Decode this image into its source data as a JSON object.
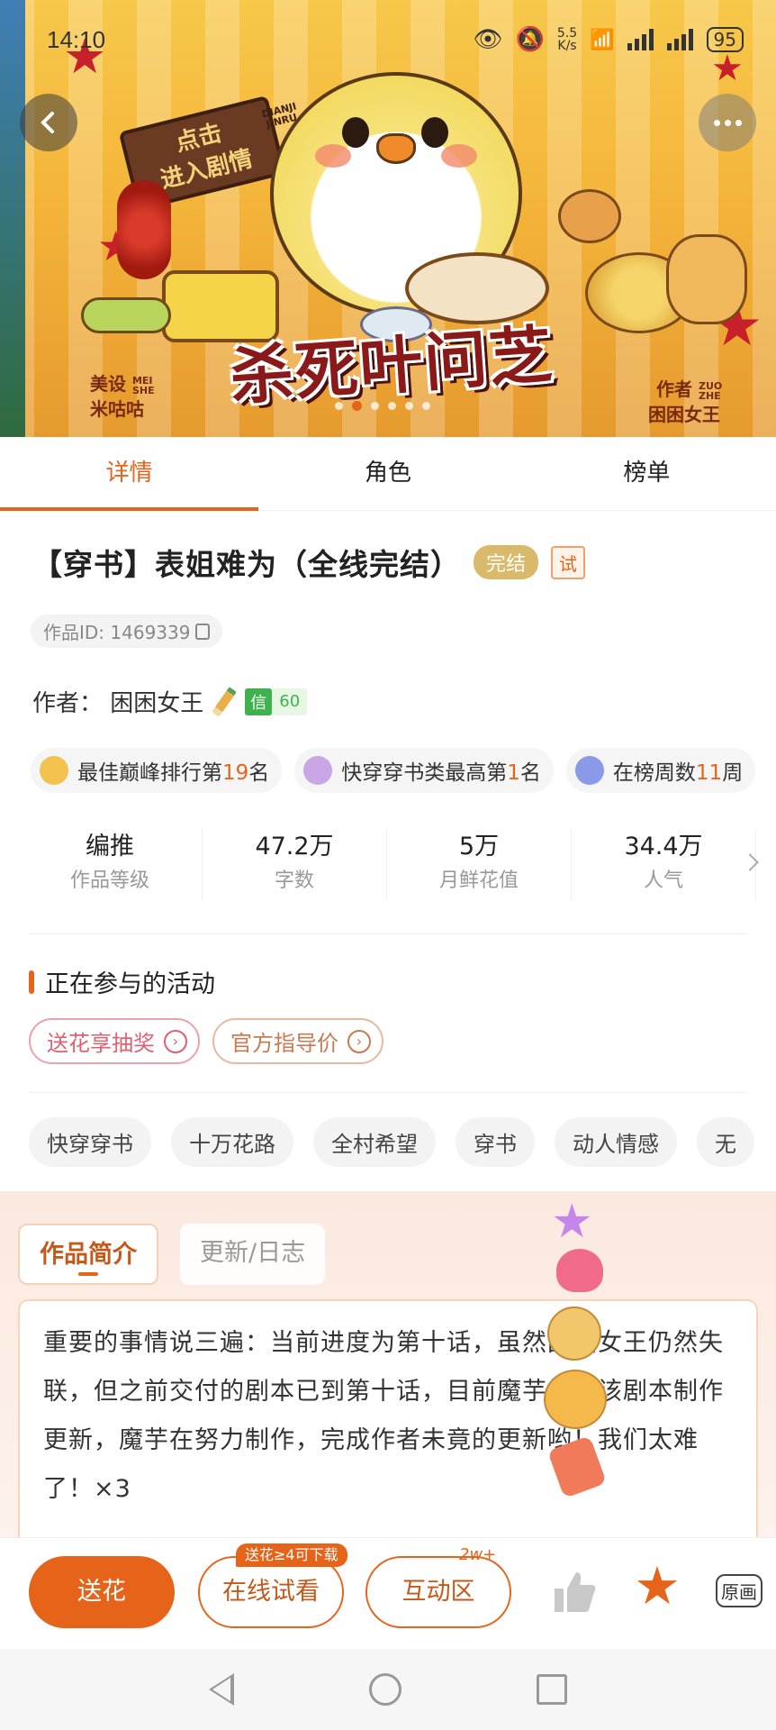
{
  "status_bar": {
    "time": "14:10",
    "net_speed": "5.5\nK/s",
    "battery": "95"
  },
  "banner": {
    "art_title": "杀死叶问芝",
    "sign_text": "点击\n进入剧情",
    "sign_pinyin": "DIANJI\nJINRU",
    "credit_left_role": "美设",
    "credit_left_latin": "MEI\nSHE",
    "credit_left_name": "米咕咕",
    "credit_right_role": "作者",
    "credit_right_latin": "ZUO\nZHE",
    "credit_right_name": "困困女王",
    "page_count": 6,
    "page_active": 2
  },
  "tabs": [
    {
      "label": "详情"
    },
    {
      "label": "角色"
    },
    {
      "label": "榜单"
    }
  ],
  "detail": {
    "title": "【穿书】表姐难为（全线完结）",
    "badge_done": "完结",
    "badge_try": "试",
    "work_id": "作品ID: 1469339",
    "author_label": "作者：",
    "author_name": "困困女王",
    "credit_tag": "信",
    "credit_score": "60"
  },
  "ranks": [
    {
      "pre": "最佳巅峰排行第",
      "num": "19",
      "post": "名",
      "color": "#f2c14e"
    },
    {
      "pre": "快穿穿书类最高第",
      "num": "1",
      "post": "名",
      "color": "#c9a7e6"
    },
    {
      "pre": "在榜周数",
      "num": "11",
      "post": "周",
      "color": "#8a9ae8"
    }
  ],
  "stats": [
    {
      "value": "编推",
      "label": "作品等级"
    },
    {
      "value": "47.2万",
      "label": "字数"
    },
    {
      "value": "5万",
      "label": "月鲜花值"
    },
    {
      "value": "34.4万",
      "label": "人气"
    }
  ],
  "activities": {
    "title": "正在参与的活动",
    "items": [
      {
        "label": "送花享抽奖"
      },
      {
        "label": "官方指导价"
      }
    ]
  },
  "tags": [
    "快穿穿书",
    "十万花路",
    "全村希望",
    "穿书",
    "动人情感",
    "无"
  ],
  "intro": {
    "tabs": [
      {
        "label": "作品简介"
      },
      {
        "label": "更新/日志"
      }
    ],
    "text": "重要的事情说三遍：当前进度为第十话，虽然困困女王仍然失联，但之前交付的剧本已到第十话，目前魔芋根据该剧本制作更新，魔芋在努力制作，完成作者未竟的更新哟！我们太难了！×3"
  },
  "bottom_bar": {
    "flower": "送花",
    "trial": "在线试看",
    "trial_bubble": "送花≥4可下载",
    "interact": "互动区",
    "interact_badge": "2w+",
    "raw": "原画"
  }
}
